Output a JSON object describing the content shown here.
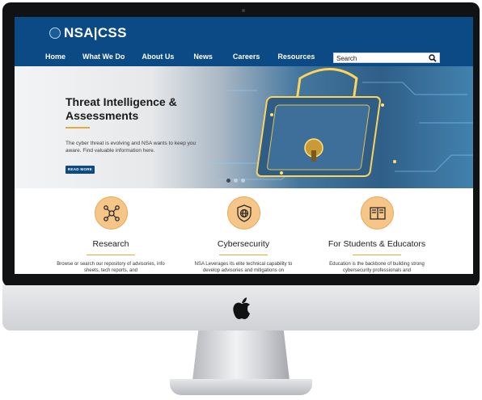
{
  "site": {
    "logo_text": "NSA|CSS"
  },
  "nav": {
    "items": [
      "Home",
      "What We Do",
      "About Us",
      "News",
      "Careers",
      "Resources"
    ]
  },
  "search": {
    "placeholder": "Search",
    "icon": "search-icon"
  },
  "hero": {
    "title": "Threat Intelligence & Assessments",
    "text": "The cyber threat is evolving and NSA wants to keep you aware. Find valuable information here.",
    "button": "READ MORE",
    "slides_total": 3,
    "active_slide": 1
  },
  "cards": [
    {
      "title": "Research",
      "text": "Browse or search our repository of advisories, info sheets, tech reports, and",
      "icon": "network-nodes-icon"
    },
    {
      "title": "Cybersecurity",
      "text": "NSA Leverages its elite technical capability to develop advisories and mitigations on",
      "icon": "globe-shield-icon"
    },
    {
      "title": "For Students & Educators",
      "text": "Education is the backbone of building strong cybersecurity professionals and",
      "icon": "book-icon"
    }
  ],
  "colors": {
    "brand_blue": "#0b4a84",
    "accent_gold": "#e8a93c",
    "icon_fill": "#f6c688"
  }
}
